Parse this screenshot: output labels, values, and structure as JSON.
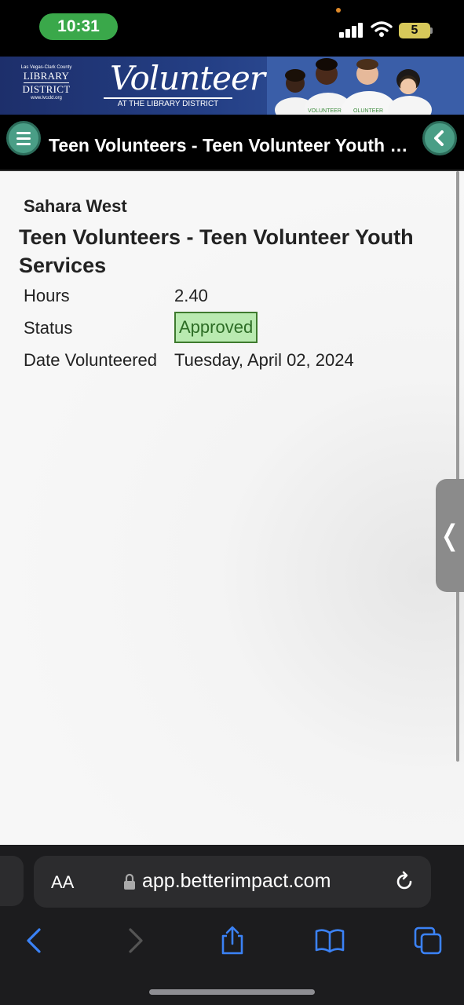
{
  "status_bar": {
    "time": "10:31",
    "battery": "5",
    "signal_icon": "cellular-signal-icon",
    "wifi_icon": "wifi-icon",
    "battery_color": "#d7c85a"
  },
  "banner": {
    "logo_small": "Las Vegas-Clark County",
    "logo_line1": "LIBRARY",
    "logo_line2": "DISTRICT",
    "logo_url": "www.lvccld.org",
    "title": "Volunteer",
    "subtitle": "AT THE LIBRARY DISTRICT"
  },
  "nav": {
    "title": "Teen Volunteers - Teen Volunteer Youth Services",
    "menu_icon": "hamburger-menu-icon",
    "back_icon": "chevron-left-icon",
    "accent": "#4a9e86"
  },
  "details": {
    "location": "Sahara West",
    "title": "Teen Volunteers - Teen Volunteer Youth Services",
    "hours_label": "Hours",
    "hours_value": "2.40",
    "status_label": "Status",
    "status_value": "Approved",
    "date_label": "Date Volunteered",
    "date_value": "Tuesday, April 02, 2024",
    "status_color": "#b9eab0"
  },
  "side_tab": {
    "glyph": "❬"
  },
  "safari": {
    "aa_label": "AA",
    "url": "app.betterimpact.com",
    "toolbar_icons": [
      "back-arrow-icon",
      "forward-arrow-icon",
      "share-icon",
      "bookmarks-icon",
      "tabs-icon"
    ]
  }
}
